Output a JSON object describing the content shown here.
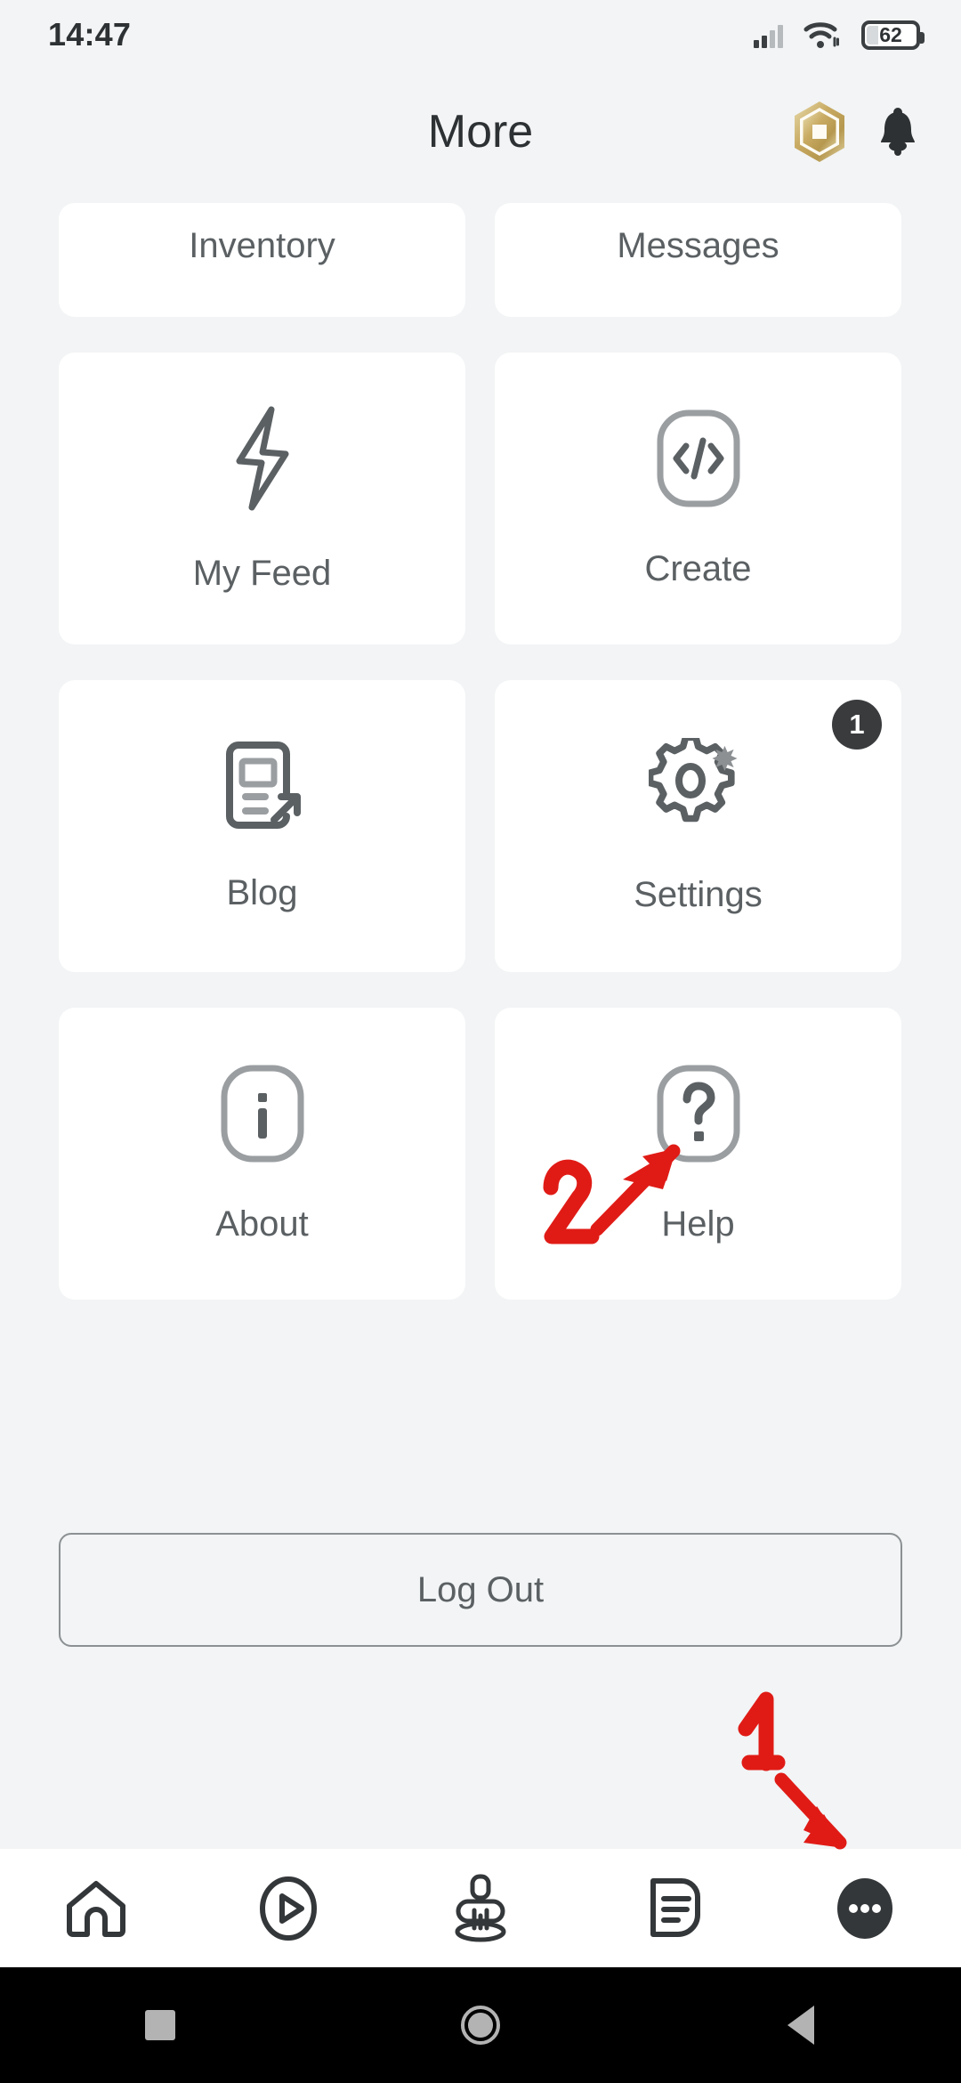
{
  "statusbar": {
    "time": "14:47",
    "battery_level": "62",
    "signal_icon": "cellular-signal-icon",
    "wifi_icon": "wifi-icon",
    "battery_icon": "battery-icon"
  },
  "header": {
    "title": "More",
    "robux_icon": "robux-icon",
    "notifications_icon": "bell-icon"
  },
  "grid": {
    "rows": [
      {
        "cards": [
          {
            "label": "Inventory",
            "icon": "inventory-icon",
            "clipped": true
          },
          {
            "label": "Messages",
            "icon": "messages-icon",
            "clipped": true
          }
        ]
      },
      {
        "cards": [
          {
            "label": "My Feed",
            "icon": "lightning-bolt-icon"
          },
          {
            "label": "Create",
            "icon": "code-brackets-icon"
          }
        ]
      },
      {
        "cards": [
          {
            "label": "Blog",
            "icon": "blog-document-icon"
          },
          {
            "label": "Settings",
            "icon": "gear-sparkle-icon",
            "badge": "1"
          }
        ]
      },
      {
        "cards": [
          {
            "label": "About",
            "icon": "info-icon"
          },
          {
            "label": "Help",
            "icon": "question-mark-icon"
          }
        ]
      }
    ]
  },
  "logout": {
    "label": "Log Out"
  },
  "bottomnav": {
    "items": [
      {
        "name": "home",
        "icon": "home-icon",
        "active": false
      },
      {
        "name": "discover",
        "icon": "play-circle-icon",
        "active": false
      },
      {
        "name": "avatar",
        "icon": "avatar-icon",
        "active": false
      },
      {
        "name": "chat",
        "icon": "chat-icon",
        "active": false
      },
      {
        "name": "more",
        "icon": "more-dots-icon",
        "active": true
      }
    ]
  },
  "androidnav": {
    "recents_icon": "square-recents-icon",
    "home_icon": "circle-home-icon",
    "back_icon": "triangle-back-icon"
  },
  "annotations": {
    "accent_color": "#e01b16",
    "marks": [
      {
        "label": "1",
        "points_to": "more-nav-button"
      },
      {
        "label": "2",
        "points_to": "settings-card"
      }
    ]
  },
  "colors": {
    "page_background": "#f2f4f5",
    "card_background": "#ffffff",
    "text_primary": "#2e3133",
    "text_secondary": "#5b6063",
    "icon_gray": "#8c9093",
    "badge_background": "#393b3d",
    "annotation_red": "#e01b16"
  }
}
